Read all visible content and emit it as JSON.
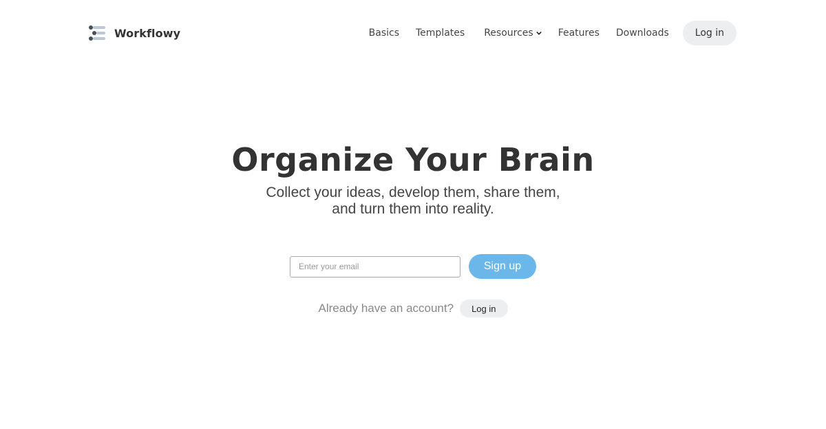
{
  "header": {
    "brand": "Workflowy",
    "logo_icon": "workflowy-logo-icon",
    "nav": [
      {
        "label": "Basics"
      },
      {
        "label": "Templates"
      },
      {
        "label": "Resources",
        "icon": "chevron-down-icon"
      },
      {
        "label": "Features"
      },
      {
        "label": "Downloads"
      }
    ],
    "login_label": "Log in"
  },
  "hero": {
    "title": "Organize Your Brain",
    "subtitle_line1": "Collect your ideas, develop them, share them,",
    "subtitle_line2": "and turn them into reality."
  },
  "signup_form": {
    "email_placeholder": "Enter your email",
    "email_value": "",
    "signup_label": "Sign up",
    "accent_color": "#6bb7ea"
  },
  "login_prompt": {
    "text": "Already have an account?",
    "login_label": "Log in"
  }
}
